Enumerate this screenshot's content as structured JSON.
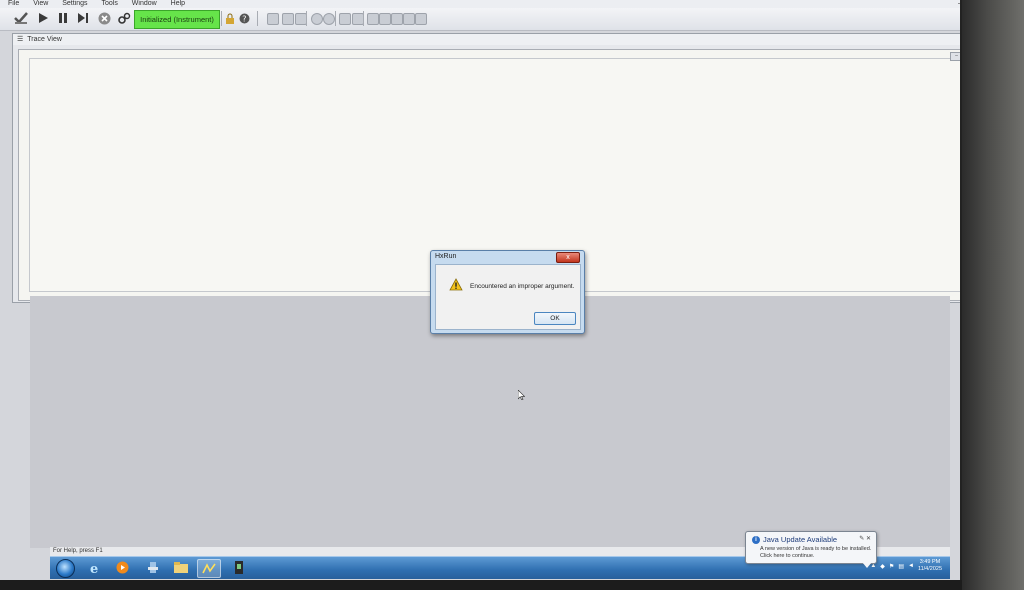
{
  "menu": {
    "items": [
      "File",
      "View",
      "Settings",
      "Tools",
      "Window",
      "Help"
    ]
  },
  "toolbar": {
    "status_label": "Initialized (Instrument)",
    "status_color": "#66e44a",
    "icons": [
      "check-icon",
      "play-icon",
      "pause-icon",
      "step-icon",
      "stop-icon",
      "gears-icon",
      "lock-icon",
      "help-icon"
    ]
  },
  "window": {
    "title": "Trace View"
  },
  "dialog": {
    "title": "HxRun",
    "message": "Encountered an improper argument.",
    "ok_label": "OK",
    "close_label": "x"
  },
  "statusbar": {
    "text": "For Help, press F1"
  },
  "notification": {
    "title": "Java Update Available",
    "line1": "A new version of Java is ready to be installed.",
    "line2": "Click here to continue."
  },
  "clock": {
    "time": "3:49 PM",
    "date": "11/4/2025"
  }
}
